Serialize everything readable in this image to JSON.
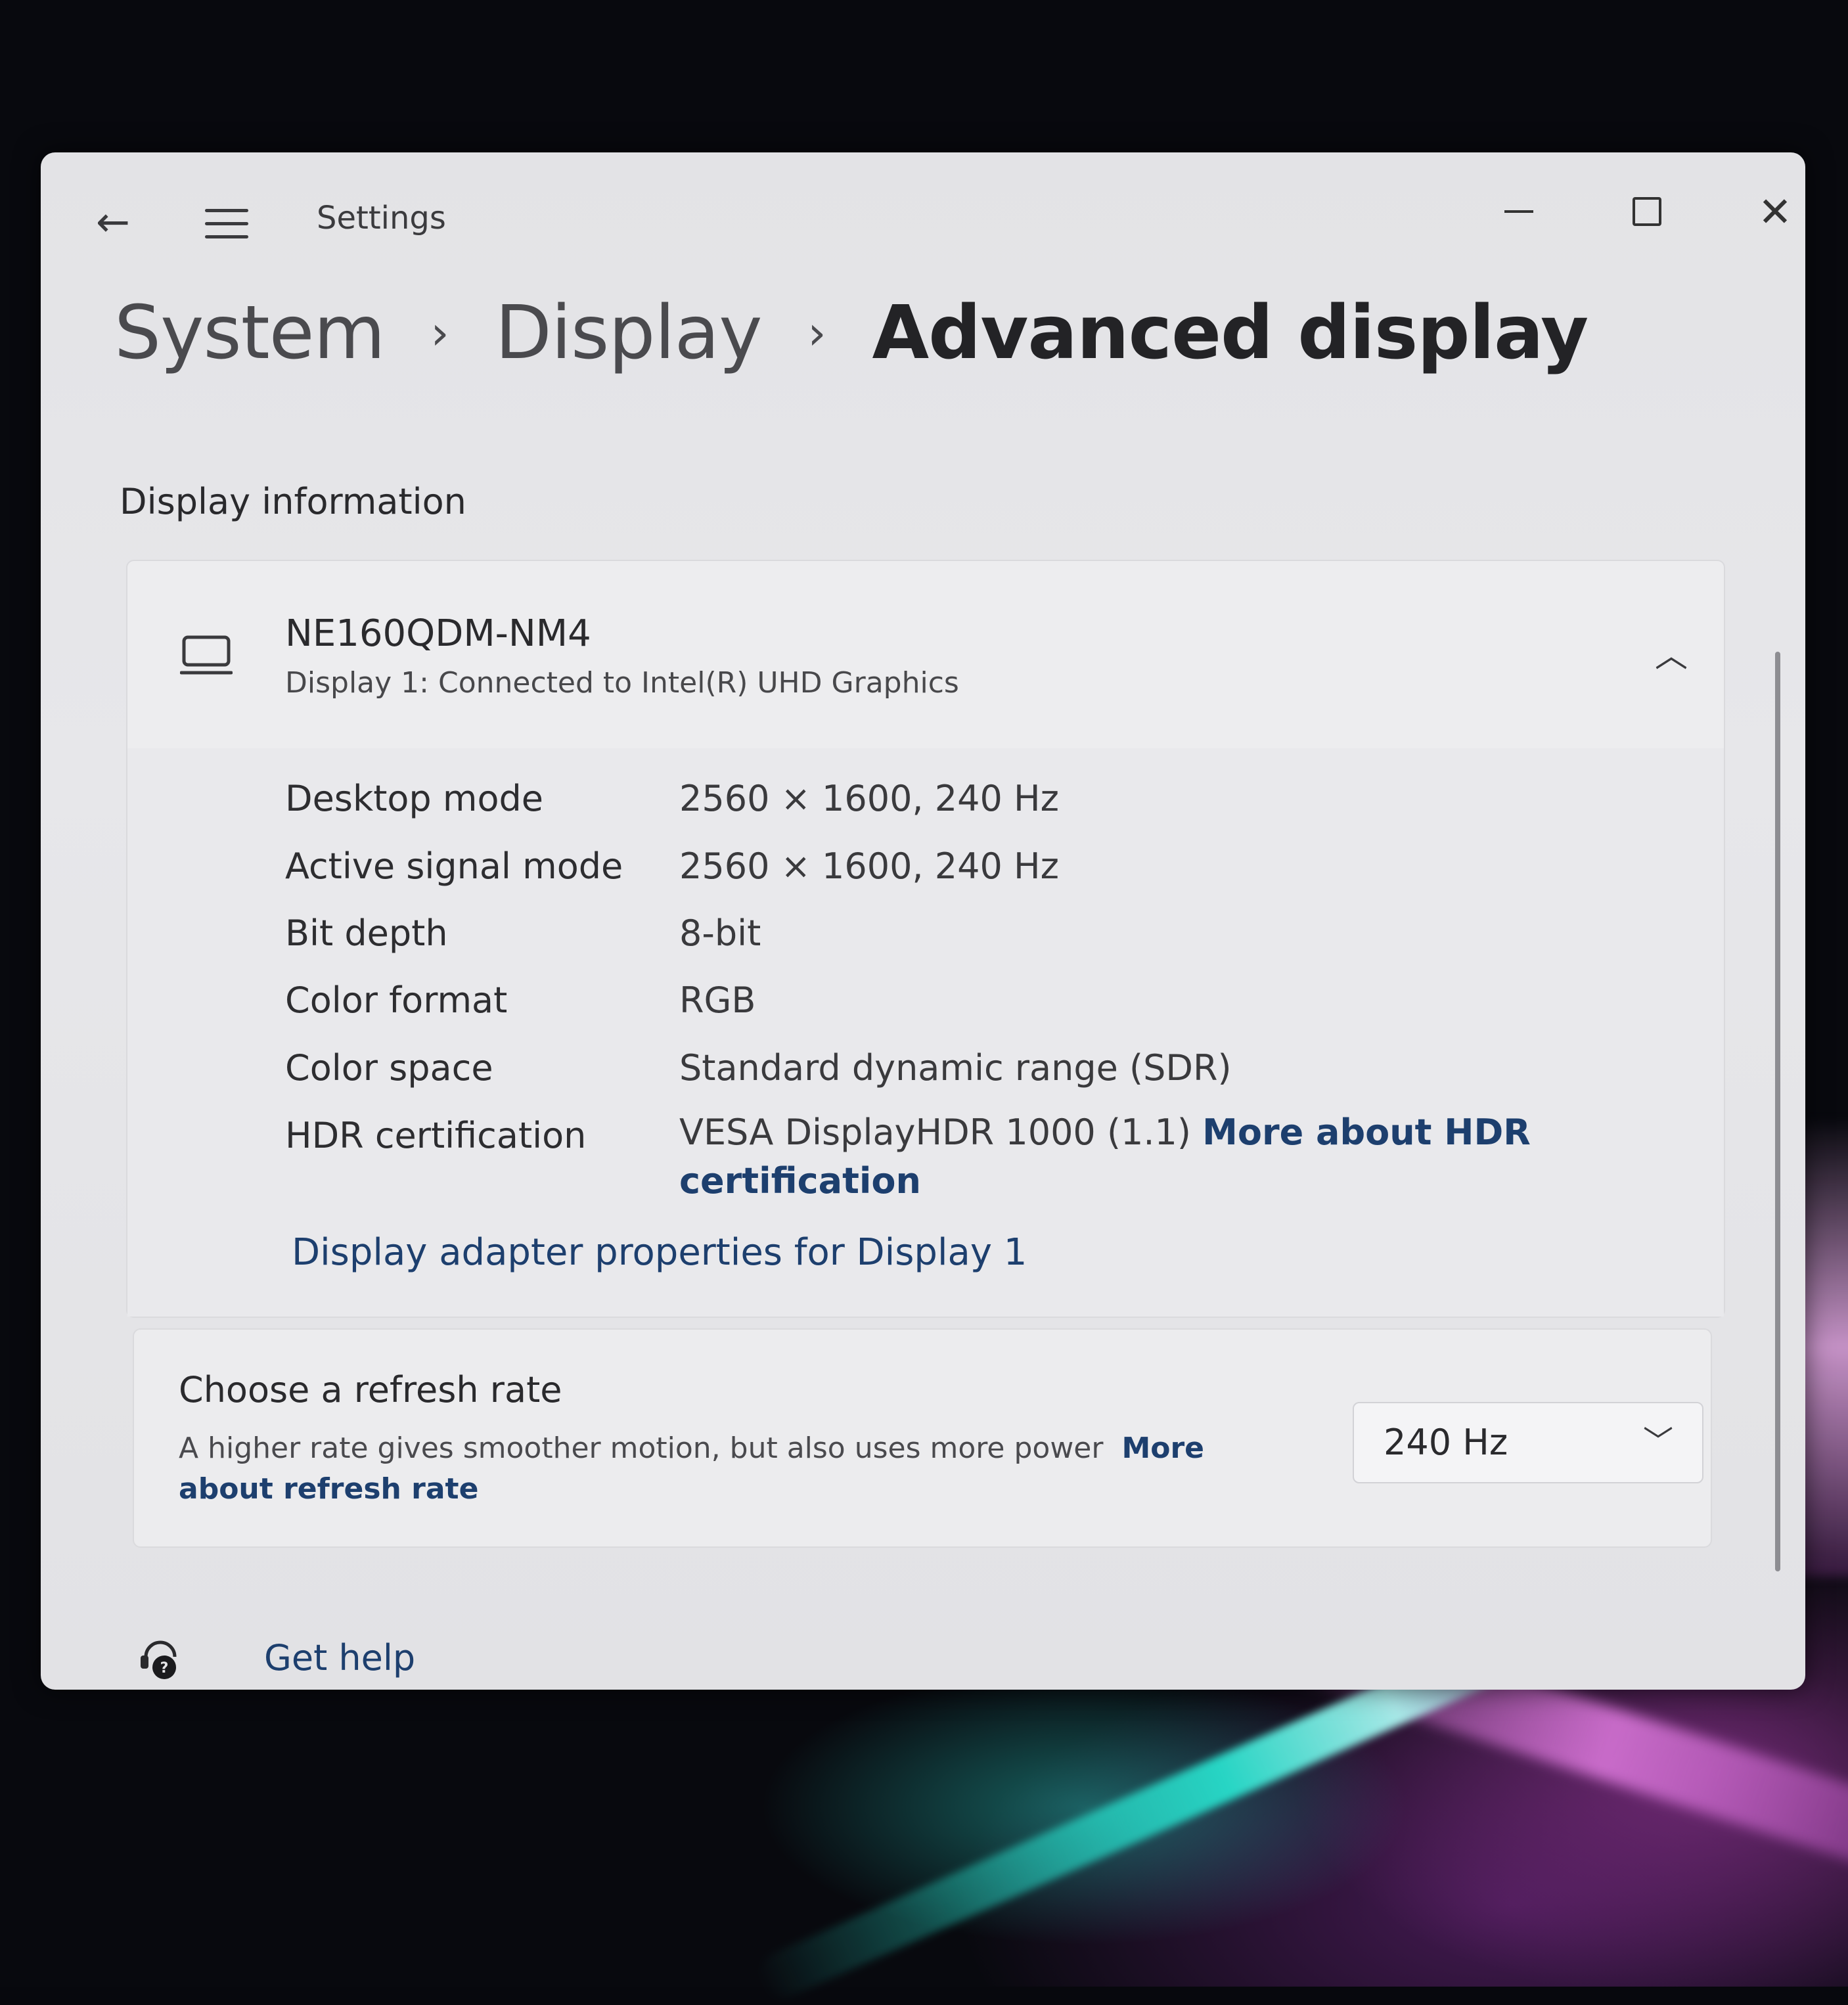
{
  "window": {
    "title": "Settings"
  },
  "breadcrumb": {
    "items": [
      "System",
      "Display",
      "Advanced display"
    ]
  },
  "section": {
    "label": "Display information"
  },
  "display": {
    "name": "NE160QDM-NM4",
    "subtitle": "Display 1: Connected to Intel(R) UHD Graphics",
    "rows": [
      {
        "key": "Desktop mode",
        "value": "2560 × 1600, 240 Hz"
      },
      {
        "key": "Active signal mode",
        "value": "2560 × 1600, 240 Hz"
      },
      {
        "key": "Bit depth",
        "value": "8-bit"
      },
      {
        "key": "Color format",
        "value": "RGB"
      },
      {
        "key": "Color space",
        "value": "Standard dynamic range (SDR)"
      },
      {
        "key": "HDR certification",
        "value": "VESA DisplayHDR 1000 (1.1)",
        "link": "More about HDR certification"
      }
    ],
    "adapter_link": "Display adapter properties for Display 1"
  },
  "refresh": {
    "title": "Choose a refresh rate",
    "description": "A higher rate gives smoother motion, but also uses more power",
    "link": "More about refresh rate",
    "selected": "240 Hz"
  },
  "help": {
    "label": "Get help"
  },
  "icons": {
    "back": "back-arrow-icon",
    "menu": "hamburger-menu-icon",
    "monitor": "monitor-icon",
    "chevron_up": "chevron-up-icon",
    "chevron_down": "chevron-down-icon",
    "help": "help-icon"
  }
}
